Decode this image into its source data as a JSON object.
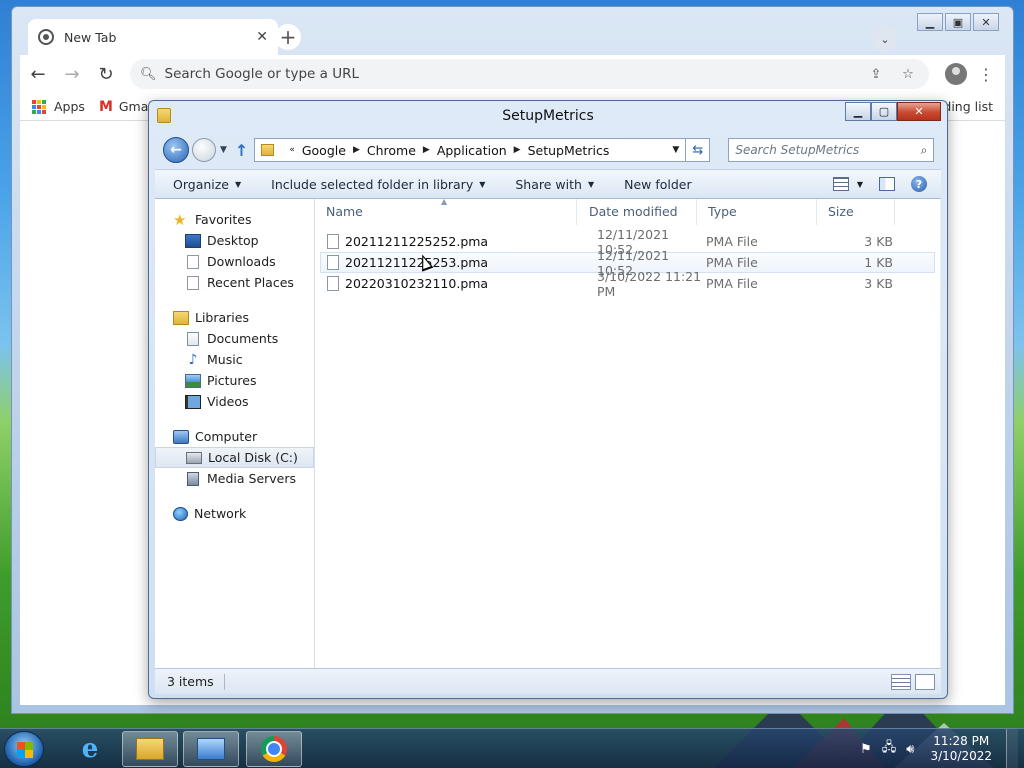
{
  "chrome": {
    "tab_title": "New Tab",
    "omnibox_placeholder": "Search Google or type a URL",
    "bookmarks": {
      "apps": "Apps",
      "gmail": "Gmail",
      "reading_list": "Reading list"
    }
  },
  "explorer": {
    "title": "SetupMetrics",
    "breadcrumb": [
      "Google",
      "Chrome",
      "Application",
      "SetupMetrics"
    ],
    "search_placeholder": "Search SetupMetrics",
    "commands": {
      "organize": "Organize",
      "include": "Include selected folder in library",
      "share": "Share with",
      "new_folder": "New folder"
    },
    "nav": {
      "favorites": {
        "label": "Favorites",
        "items": [
          "Desktop",
          "Downloads",
          "Recent Places"
        ]
      },
      "libraries": {
        "label": "Libraries",
        "items": [
          "Documents",
          "Music",
          "Pictures",
          "Videos"
        ]
      },
      "computer": {
        "label": "Computer",
        "items": [
          "Local Disk (C:)",
          "Media Servers"
        ]
      },
      "network": {
        "label": "Network"
      }
    },
    "columns": {
      "name": "Name",
      "date": "Date modified",
      "type": "Type",
      "size": "Size"
    },
    "files": [
      {
        "name": "20211211225252.pma",
        "date": "12/11/2021 10:52 ...",
        "type": "PMA File",
        "size": "3 KB"
      },
      {
        "name": "20211211225253.pma",
        "date": "12/11/2021 10:52 ...",
        "type": "PMA File",
        "size": "1 KB"
      },
      {
        "name": "20220310232110.pma",
        "date": "3/10/2022 11:21 PM",
        "type": "PMA File",
        "size": "3 KB"
      }
    ],
    "status": "3 items"
  },
  "taskbar": {
    "time": "11:28 PM",
    "date": "3/10/2022"
  },
  "colors": {
    "apps_grid": [
      "#ea4335",
      "#fbbc04",
      "#34a853",
      "#4285f4",
      "#ea4335",
      "#fbbc04",
      "#34a853",
      "#4285f4",
      "#ea4335"
    ]
  }
}
